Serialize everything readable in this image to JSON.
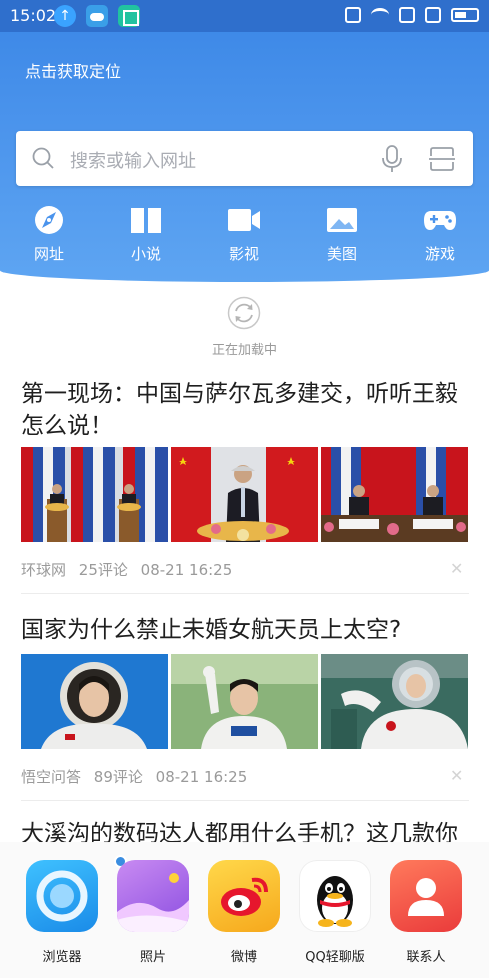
{
  "status_bar": {
    "time": "15:02"
  },
  "header": {
    "location_label": "点击获取定位"
  },
  "search": {
    "placeholder": "搜索或输入网址"
  },
  "quick_links": [
    {
      "label": "网址",
      "icon": "compass-icon"
    },
    {
      "label": "小说",
      "icon": "book-icon"
    },
    {
      "label": "影视",
      "icon": "video-camera-icon"
    },
    {
      "label": "美图",
      "icon": "picture-icon"
    },
    {
      "label": "游戏",
      "icon": "gamepad-icon"
    }
  ],
  "feed": {
    "loading_text": "正在加载中",
    "articles": [
      {
        "title": "第一现场：中国与萨尔瓦多建交，听听王毅怎么说！",
        "source": "环球网",
        "comments": "25评论",
        "time": "08-21 16:25"
      },
      {
        "title": "国家为什么禁止未婚女航天员上太空?",
        "source": "悟空问答",
        "comments": "89评论",
        "time": "08-21 16:25"
      },
      {
        "title": "大溪沟的数码达人都用什么手机？这几款你"
      }
    ]
  },
  "dock": {
    "apps": [
      {
        "label": "浏览器",
        "icon": "browser-icon"
      },
      {
        "label": "照片",
        "icon": "photos-icon"
      },
      {
        "label": "微博",
        "icon": "weibo-icon"
      },
      {
        "label": "QQ轻聊版",
        "icon": "qq-icon"
      },
      {
        "label": "联系人",
        "icon": "contacts-icon"
      }
    ]
  },
  "colors": {
    "header_blue": "#3a86e6",
    "status_bar": "#2f6fcc",
    "text_muted": "#9a9a9a"
  }
}
